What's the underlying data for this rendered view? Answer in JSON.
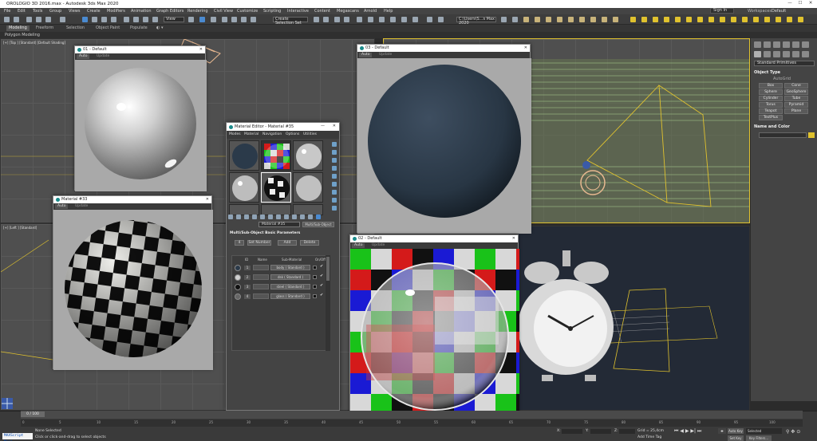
{
  "app": {
    "title": "OROLOGIO 3D 2016.max - Autodesk 3ds Max 2020",
    "window_controls": [
      "—",
      "☐",
      "✕"
    ]
  },
  "menu": {
    "items": [
      "File",
      "Edit",
      "Tools",
      "Group",
      "Views",
      "Create",
      "Modifiers",
      "Animation",
      "Graph Editors",
      "Rendering",
      "Civil View",
      "Customize",
      "Scripting",
      "Interactive",
      "Content",
      "Megascans",
      "Arnold",
      "Help"
    ],
    "sign_in": "Sign In",
    "workspaces_label": "Workspaces:",
    "workspace_value": "Default"
  },
  "toolbar": {
    "view_dropdown": "View",
    "selection_set": "Create Selection Set",
    "path_field": "C:\\Users\\S...s Max 2020"
  },
  "ribbon": {
    "tabs": [
      "Modeling",
      "Freeform",
      "Selection",
      "Object Paint",
      "Populate"
    ],
    "active": "Modeling",
    "sub_label": "Polygon Modeling"
  },
  "viewports": {
    "top_left_label": "[+] [Top ] [Standard] [Default Shading]",
    "left_label": "[+] [Left ] [Standard]"
  },
  "command_panel": {
    "dropdown": "Standard Primitives",
    "object_type_title": "Object Type",
    "autogrid": "AutoGrid",
    "buttons": [
      "Box",
      "Cone",
      "Sphere",
      "GeoSphere",
      "Cylinder",
      "Tube",
      "Torus",
      "Pyramid",
      "Teapot",
      "Plane",
      "TextPlus"
    ],
    "name_color_title": "Name and Color"
  },
  "previews": [
    {
      "id": "p1",
      "title": "01 - Default",
      "tab_auto": "Auto",
      "tab_update": "Update"
    },
    {
      "id": "p2",
      "title": "Material #33",
      "tab_auto": "Auto",
      "tab_update": "Update"
    },
    {
      "id": "p3",
      "title": "03 - Default",
      "tab_auto": "Auto",
      "tab_update": "Update"
    },
    {
      "id": "p4",
      "title": "02 - Default",
      "tab_auto": "Auto",
      "tab_update": "Update"
    }
  ],
  "material_editor": {
    "title": "Material Editor - Material #35",
    "menus": [
      "Modes",
      "Material",
      "Navigation",
      "Options",
      "Utilities"
    ],
    "material_name": "Material #35",
    "material_type": "Multi/Sub-Object",
    "rollout_title": "Multi/Sub-Object Basic Parameters",
    "count": "4",
    "set_number": "Set Number",
    "add": "Add",
    "delete": "Delete",
    "headers": [
      "ID",
      "Name",
      "Sub-Material",
      "On/Off"
    ],
    "rows": [
      {
        "id": "1",
        "sub": "body ( Standard )",
        "ball_color": "#2b3a4a"
      },
      {
        "id": "2",
        "sub": "dsk ( Standard )",
        "ball_color": "#d0d0d0"
      },
      {
        "id": "3",
        "sub": "steel ( Standard )",
        "ball_color": "#111111"
      },
      {
        "id": "4",
        "sub": "glass ( Standard )",
        "ball_color": "#666666"
      }
    ],
    "check": "✔"
  },
  "timeline": {
    "frame": "0 / 100",
    "ticks": [
      "0",
      "5",
      "10",
      "15",
      "20",
      "25",
      "30",
      "35",
      "40",
      "45",
      "50",
      "55",
      "60",
      "65",
      "70",
      "75",
      "80",
      "85",
      "90",
      "95",
      "100"
    ]
  },
  "status": {
    "maxscript": "MAXScript Mini",
    "selection": "None Selected",
    "prompt": "Click or click-and-drag to select objects",
    "x_label": "X:",
    "y_label": "Y:",
    "z_label": "Z:",
    "grid": "Grid = 25,4cm",
    "add_time_tag": "Add Time Tag",
    "auto_key": "Auto Key",
    "selected": "Selected",
    "set_key": "Set Key",
    "key_filters": "Key Filters..."
  },
  "colors": {
    "accent_yellow": "#e0c22e",
    "viewport_bg": "#4f4f4f",
    "dark_blue_bg": "#232a36"
  }
}
